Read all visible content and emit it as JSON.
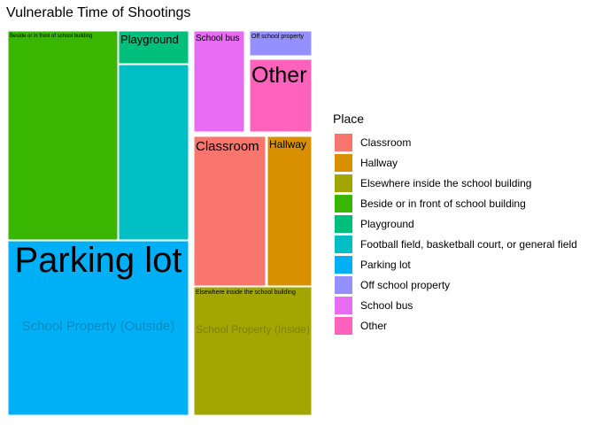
{
  "chart_data": {
    "type": "treemap",
    "title": "Vulnerable Time of Shootings",
    "legend": {
      "title": "Place",
      "placement": "right",
      "items": [
        {
          "label": "Classroom",
          "color": "#F8766D"
        },
        {
          "label": "Hallway",
          "color": "#D89000"
        },
        {
          "label": "Elsewhere inside the school building",
          "color": "#A3A500"
        },
        {
          "label": "Beside or in front of school building",
          "color": "#39B600"
        },
        {
          "label": "Playground",
          "color": "#00BF7D"
        },
        {
          "label": "Football field, basketball court, or general field",
          "color": "#00BFC4"
        },
        {
          "label": "Parking lot",
          "color": "#00B0F6"
        },
        {
          "label": "Off school property",
          "color": "#9590FF"
        },
        {
          "label": "School bus",
          "color": "#E76BF3"
        },
        {
          "label": "Other",
          "color": "#FF62BC"
        }
      ]
    },
    "groups": [
      {
        "label": "School Property (Outside)",
        "tiles": [
          {
            "place": "Beside or in front of school building",
            "label": "Beside or in front of school building"
          },
          {
            "place": "Playground",
            "label": "Playground"
          },
          {
            "place": "Football field, basketball court, or general field",
            "label": ""
          },
          {
            "place": "Parking lot",
            "label": "Parking lot"
          }
        ]
      },
      {
        "label": "",
        "tiles": [
          {
            "place": "School bus",
            "label": "School bus"
          },
          {
            "place": "Off school property",
            "label": "Off school property"
          },
          {
            "place": "Other",
            "label": "Other"
          }
        ]
      },
      {
        "label": "School Property (Inside)",
        "tiles": [
          {
            "place": "Classroom",
            "label": "Classroom"
          },
          {
            "place": "Hallway",
            "label": "Hallway"
          },
          {
            "place": "Elsewhere inside the school building",
            "label": "Elsewhere inside the school building"
          }
        ]
      }
    ]
  }
}
